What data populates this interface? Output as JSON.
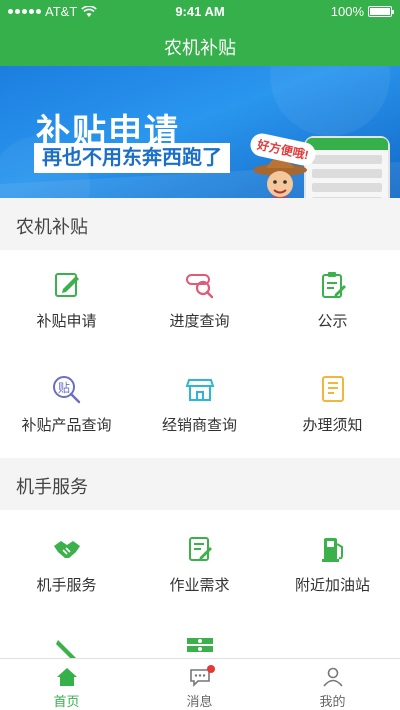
{
  "status": {
    "carrier": "AT&T",
    "time": "9:41 AM",
    "battery": "100%"
  },
  "header": {
    "title": "农机补贴"
  },
  "banner": {
    "line1": "补贴申请",
    "line2": "再也不用东奔西跑了",
    "bubble": "好方便哦!"
  },
  "sections": [
    {
      "title": "农机补贴",
      "items": [
        {
          "label": "补贴申请",
          "icon": "edit-icon"
        },
        {
          "label": "进度查询",
          "icon": "search-progress-icon"
        },
        {
          "label": "公示",
          "icon": "clipboard-icon"
        },
        {
          "label": "补贴产品查询",
          "icon": "subsidy-search-icon"
        },
        {
          "label": "经销商查询",
          "icon": "store-icon"
        },
        {
          "label": "办理须知",
          "icon": "notice-icon"
        }
      ]
    },
    {
      "title": "机手服务",
      "items": [
        {
          "label": "机手服务",
          "icon": "handshake-icon"
        },
        {
          "label": "作业需求",
          "icon": "task-icon"
        },
        {
          "label": "附近加油站",
          "icon": "fuel-icon"
        }
      ]
    }
  ],
  "tabs": [
    {
      "label": "首页",
      "icon": "home-icon"
    },
    {
      "label": "消息",
      "icon": "message-icon"
    },
    {
      "label": "我的",
      "icon": "user-icon"
    }
  ],
  "colors": {
    "brand": "#35b04a",
    "banner": "#1c7ee0"
  }
}
